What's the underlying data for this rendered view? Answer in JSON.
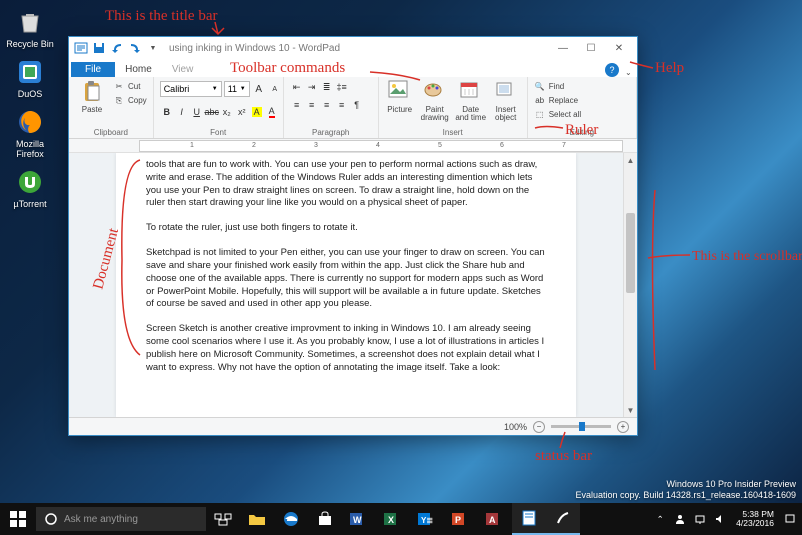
{
  "desktop": {
    "icons": [
      {
        "name": "recycle-bin",
        "label": "Recycle Bin"
      },
      {
        "name": "duos",
        "label": "DuOS"
      },
      {
        "name": "firefox",
        "label": "Mozilla Firefox"
      },
      {
        "name": "utorrent",
        "label": "µTorrent"
      }
    ]
  },
  "wordpad": {
    "qat": {
      "save": "save",
      "undo": "undo",
      "redo": "redo"
    },
    "title": "using inking in Windows 10 - WordPad",
    "tabs": {
      "file": "File",
      "home": "Home",
      "view": "View"
    },
    "ribbon": {
      "clipboard": {
        "label": "Clipboard",
        "paste": "Paste",
        "cut": "Cut",
        "copy": "Copy"
      },
      "font": {
        "label": "Font",
        "name": "Calibri",
        "size": "11"
      },
      "paragraph": {
        "label": "Paragraph"
      },
      "insert": {
        "label": "Insert",
        "picture": "Picture",
        "paint": "Paint drawing",
        "datetime": "Date and time",
        "object": "Insert object"
      },
      "editing": {
        "label": "Editing",
        "find": "Find",
        "replace": "Replace",
        "selectall": "Select all"
      }
    },
    "ruler_numbers": [
      "1",
      "2",
      "3",
      "4",
      "5",
      "6",
      "7"
    ],
    "document": {
      "p1": "tools that are fun to work with. You can use your pen to perform normal actions such as draw, write and erase. The addition of the Windows Ruler adds an interesting dimention which lets you use your Pen to draw straight lines on screen. To draw a straight line, hold down on the ruler then start drawing your line like you would on a physical sheet of paper.",
      "p2": "To rotate the ruler, just use both fingers to rotate it.",
      "p3": "Sketchpad is not limited to your Pen either, you can use your finger to draw on screen. You can save and share your finished work easily from within the app. Just click the Share hub and choose one of the available apps. There is currently no support for modern apps such as Word or PowerPoint Mobile. Hopefully, this will support will be available a in future update. Sketches of course be saved and used in other app you please.",
      "p4": "Screen Sketch is another creative improvment to inking in Windows 10. I am already seeing some cool scenarios where I use it. As you probably know, I use a lot of illustrations in articles I publish here on Microsoft Community. Sometimes, a screenshot does not explain detail what I want to express. Why not have the option of annotating the image itself. Take a look:"
    },
    "status": {
      "zoom": "100%"
    }
  },
  "taskbar": {
    "search_placeholder": "Ask me anything",
    "time": "5:38 PM",
    "date": "4/23/2016"
  },
  "watermark": {
    "line1": "Windows 10 Pro Insider Preview",
    "line2": "Evaluation copy. Build 14328.rs1_release.160418-1609"
  },
  "annotations": {
    "title_bar": "This is the title bar",
    "toolbar": "Toolbar commands",
    "help": "Help",
    "ruler": "Ruler",
    "document": "Document",
    "scrollbar": "This is the scrollbar",
    "statusbar": "status bar"
  }
}
